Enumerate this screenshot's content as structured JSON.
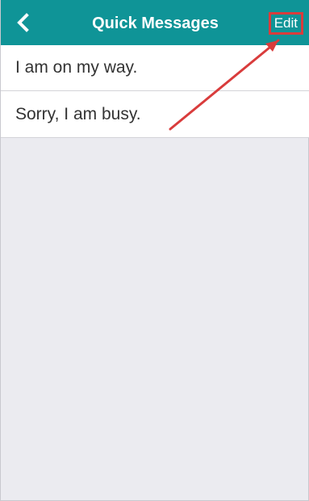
{
  "header": {
    "title": "Quick Messages",
    "edit_label": "Edit",
    "back_icon": "chevron-left-icon"
  },
  "messages": [
    {
      "text": "I am on my way."
    },
    {
      "text": "Sorry, I am busy."
    }
  ],
  "colors": {
    "header_bg": "#0f9497",
    "page_bg": "#ebebf0",
    "list_bg": "#ffffff",
    "annotation": "#d93c3c"
  }
}
